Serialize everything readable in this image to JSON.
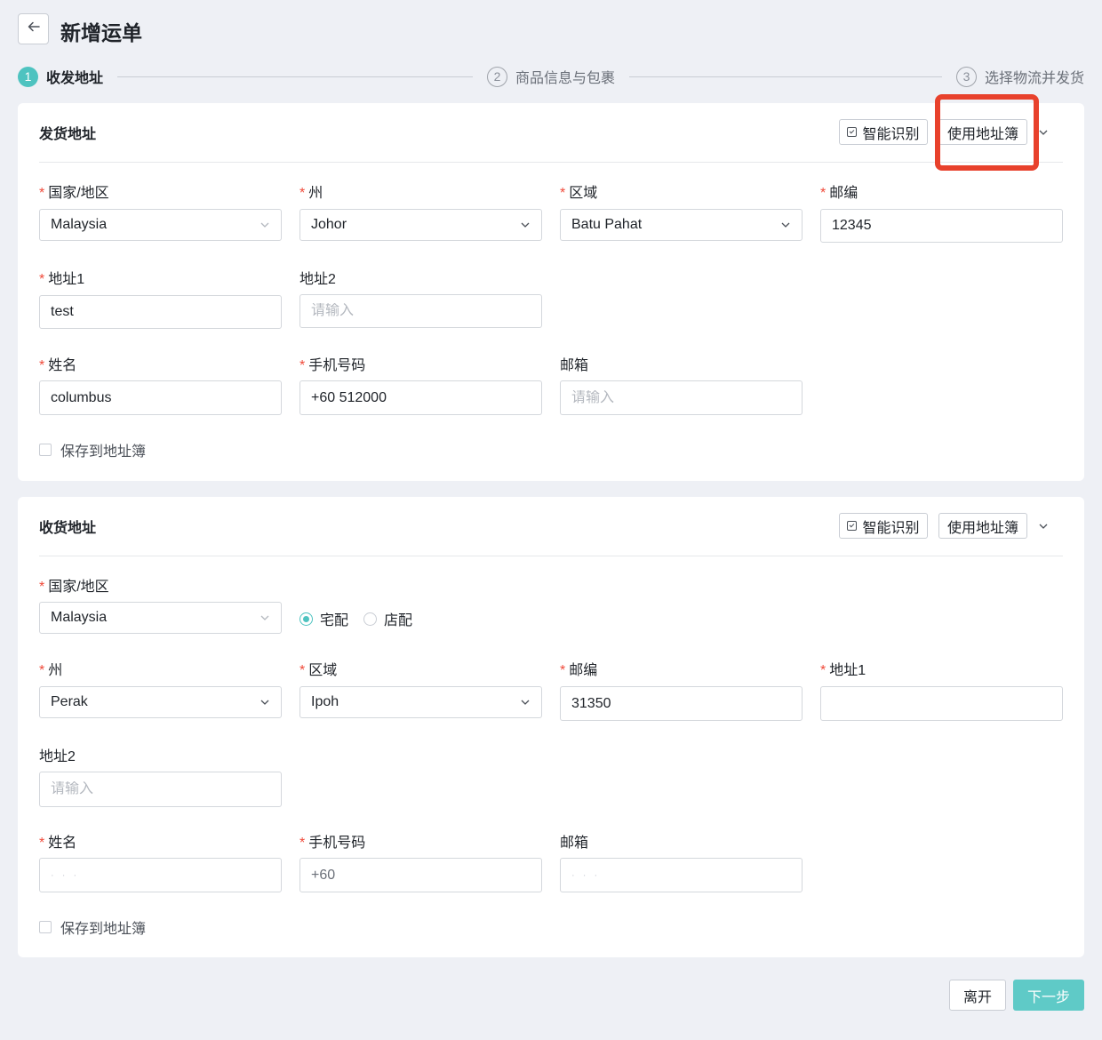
{
  "header": {
    "title": "新增运单"
  },
  "steps": [
    {
      "num": "1",
      "label": "收发地址"
    },
    {
      "num": "2",
      "label": "商品信息与包裹"
    },
    {
      "num": "3",
      "label": "选择物流并发货"
    }
  ],
  "sender": {
    "title": "发货地址",
    "smart_label": "智能识别",
    "address_book_label": "使用地址簿",
    "country_label": "国家/地区",
    "country_value": "Malaysia",
    "state_label": "州",
    "state_value": "Johor",
    "region_label": "区域",
    "region_value": "Batu Pahat",
    "zip_label": "邮编",
    "zip_value": "12345",
    "addr1_label": "地址1",
    "addr1_value": "test",
    "addr2_label": "地址2",
    "addr2_placeholder": "请输入",
    "name_label": "姓名",
    "name_value": "columbus",
    "phone_label": "手机号码",
    "phone_value": "+60 512000",
    "email_label": "邮箱",
    "email_placeholder": "请输入",
    "save_label": "保存到地址簿"
  },
  "receiver": {
    "title": "收货地址",
    "smart_label": "智能识别",
    "address_book_label": "使用地址簿",
    "country_label": "国家/地区",
    "country_value": "Malaysia",
    "delivery_home_label": "宅配",
    "delivery_store_label": "店配",
    "state_label": "州",
    "state_value": "Perak",
    "region_label": "区域",
    "region_value": "Ipoh",
    "zip_label": "邮编",
    "zip_value": "31350",
    "addr1_label": "地址1",
    "addr1_value": "",
    "addr2_label": "地址2",
    "addr2_placeholder": "请输入",
    "name_label": "姓名",
    "phone_label": "手机号码",
    "phone_value": "+60",
    "email_label": "邮箱",
    "save_label": "保存到地址簿"
  },
  "footer": {
    "leave_label": "离开",
    "next_label": "下一步"
  },
  "colors": {
    "accent": "#4ec3c0",
    "required": "#f04a3a",
    "highlight": "#e8412c"
  }
}
